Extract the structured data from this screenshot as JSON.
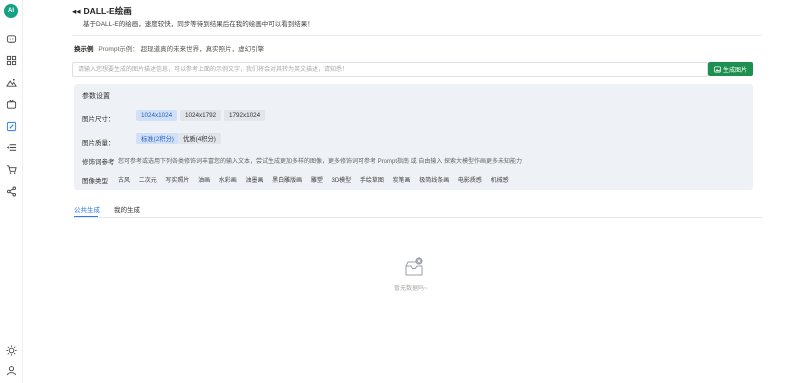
{
  "sidebar": {
    "logo_text": "AI",
    "accent_color": "#16a085",
    "icons": [
      "chat-icon",
      "apps-icon",
      "image-icon",
      "video-icon",
      "draw-icon",
      "list-icon",
      "cart-icon",
      "share-icon",
      "theme-icon",
      "user-icon"
    ]
  },
  "header": {
    "title": "DALL-E绘画",
    "subtitle": "基于DALL-E的绘画，速度较快，同步等待到结果后在我的绘画中可以看到结果！"
  },
  "examples": {
    "label": "换示例",
    "prefix": "Prompt示例：",
    "items": [
      "超现道真的未来世界，真实照片，虚幻引擎"
    ]
  },
  "prompt": {
    "placeholder": "请输入您想要生成的图片描述信息，可以参考上面的示例文字，我们将会对其转为英文描述，请知悉！",
    "value": ""
  },
  "generate_button": {
    "label": "生成图片",
    "color": "#1d8f4e"
  },
  "params": {
    "title": "参数设置",
    "size_label": "图片尺寸：",
    "sizes": [
      "1024x1024",
      "1024x1792",
      "1792x1024"
    ],
    "selected_size": "1024x1024",
    "quality_label": "图片质量：",
    "qualities": [
      "标准(2积分)",
      "优质(4积分)"
    ],
    "selected_quality": "标准(2积分)",
    "modifier_label": "修饰词参考",
    "modifier_hint": "您可参考或选用下列各类修饰词丰富您的输入文本，尝试生成更加多样的图像，更多修饰词可参考 Prompt指南 或 自由输入 探索大模型作画更多未知能力",
    "style_label": "图像类型",
    "styles": [
      "古风",
      "二次元",
      "写实照片",
      "油画",
      "水彩画",
      "油墨画",
      "黑白雕版画",
      "雕塑",
      "3D模型",
      "手绘草图",
      "炭笔画",
      "极简线条画",
      "电影质感",
      "机械感"
    ]
  },
  "tabs": [
    {
      "label": "公共生成",
      "active": true
    },
    {
      "label": "我的生成",
      "active": false
    }
  ],
  "empty_state": {
    "text": "暂无数据吗~"
  }
}
